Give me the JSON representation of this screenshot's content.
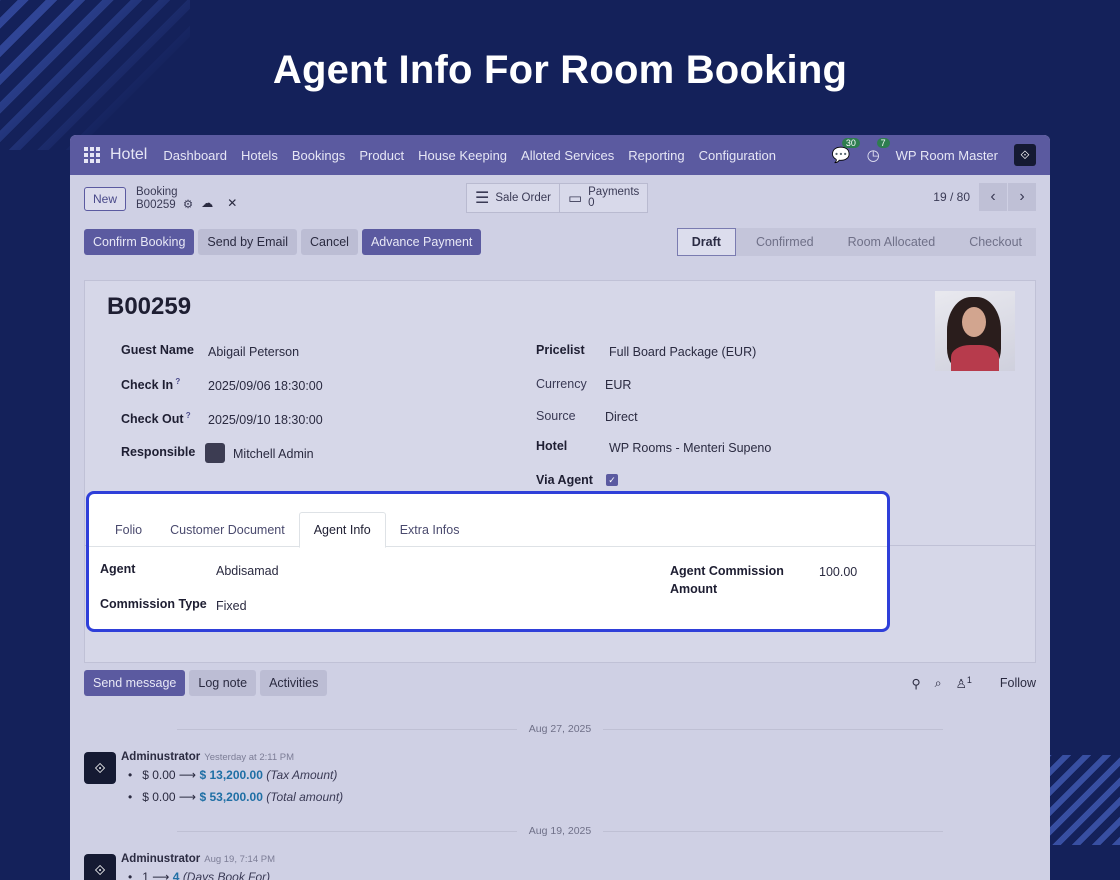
{
  "hero_title": "Agent Info For Room Booking",
  "navbar": {
    "brand": "Hotel",
    "items": [
      "Dashboard",
      "Hotels",
      "Bookings",
      "Product",
      "House Keeping",
      "Alloted Services",
      "Reporting",
      "Configuration"
    ],
    "messages_count": "30",
    "activities_count": "7",
    "company": "WP Room Master"
  },
  "control_panel": {
    "new_label": "New",
    "breadcrumb_parent": "Booking",
    "record_ref": "B00259",
    "sale_order_label": "Sale Order",
    "payments_label": "Payments",
    "payments_count": "0",
    "pager": "19 / 80"
  },
  "actions": {
    "confirm_booking": "Confirm Booking",
    "send_by_email": "Send by Email",
    "cancel": "Cancel",
    "advance_payment": "Advance Payment"
  },
  "statusbar": [
    "Draft",
    "Confirmed",
    "Room Allocated",
    "Checkout"
  ],
  "form": {
    "title": "B00259",
    "guest_name_label": "Guest Name",
    "guest_name": "Abigail Peterson",
    "check_in_label": "Check In",
    "check_in": "2025/09/06 18:30:00",
    "check_out_label": "Check Out",
    "check_out": "2025/09/10 18:30:00",
    "responsible_label": "Responsible",
    "responsible": "Mitchell Admin",
    "pricelist_label": "Pricelist",
    "pricelist": "Full Board Package (EUR)",
    "currency_label": "Currency",
    "currency": "EUR",
    "source_label": "Source",
    "source": "Direct",
    "hotel_label": "Hotel",
    "hotel": "WP Rooms - Menteri Supeno",
    "via_agent_label": "Via Agent",
    "via_agent_checked": true
  },
  "tabs": [
    "Folio",
    "Customer Document",
    "Agent Info",
    "Extra Infos"
  ],
  "agent_info": {
    "agent_label": "Agent",
    "agent": "Abdisamad",
    "commission_type_label": "Commission Type",
    "commission_type": "Fixed",
    "commission_amount_label_1": "Agent Commission",
    "commission_amount_label_2": "Amount",
    "commission_amount": "100.00"
  },
  "chatter": {
    "send_message": "Send message",
    "log_note": "Log note",
    "activities": "Activities",
    "followers_count": "1",
    "follow": "Follow",
    "messages": [
      {
        "date": "Aug 27, 2025",
        "author": "Adminustrator",
        "time": "Yesterday at 2:11 PM",
        "changes": [
          {
            "old": "$ 0.00",
            "new": "$ 13,200.00",
            "field": "(Tax Amount)"
          },
          {
            "old": "$ 0.00",
            "new": "$ 53,200.00",
            "field": "(Total amount)"
          }
        ]
      },
      {
        "date": "Aug 19, 2025",
        "author": "Adminustrator",
        "time": "Aug 19, 7:14 PM",
        "changes": [
          {
            "old": "1",
            "new": "4",
            "field": "(Days Book For)"
          }
        ]
      }
    ]
  }
}
